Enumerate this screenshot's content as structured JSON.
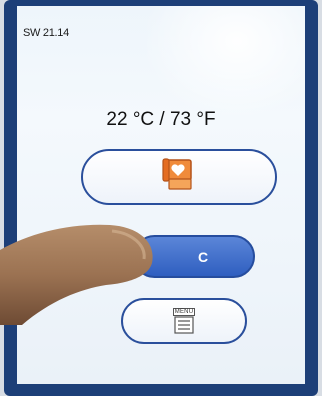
{
  "status": {
    "version": "SW 21.14"
  },
  "display": {
    "temperature": "22 °C / 73 °F"
  },
  "buttons": {
    "heart": {
      "icon": "heart-card-icon"
    },
    "clear": {
      "label": "C"
    },
    "menu": {
      "label": "MENU",
      "icon": "menu-list-icon"
    }
  },
  "colors": {
    "bezel": "#1d3f78",
    "pill_border": "#2a4f9c",
    "active_pill": "#3a68c8",
    "heart_icon": "#e8742a"
  }
}
